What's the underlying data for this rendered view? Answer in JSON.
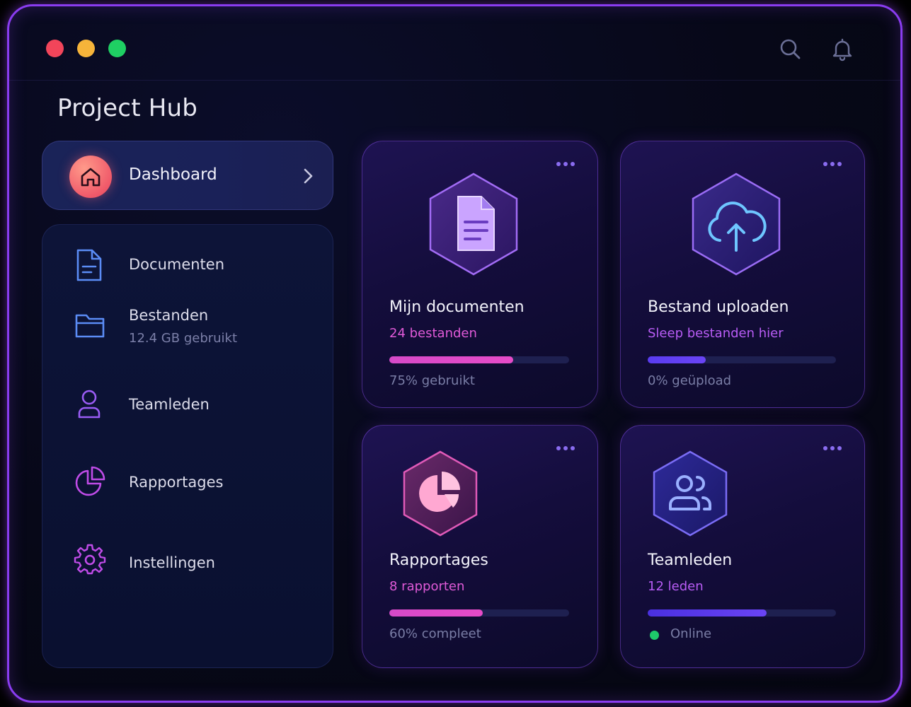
{
  "window": {
    "title": "Project Hub"
  },
  "colors": {
    "accent_purple": "#8a3cf0",
    "pink": "#e64bc8",
    "violet": "#5a3cf0",
    "online_green": "#1ec96a"
  },
  "titlebar": {
    "icons": [
      "search-icon",
      "bell-icon"
    ]
  },
  "sidebar": {
    "dashboard": {
      "label": "Dashboard",
      "icon": "home-icon"
    },
    "items": [
      {
        "label": "Documenten",
        "icon": "document-icon"
      },
      {
        "label": "Bestanden",
        "sub": "12.4 GB gebruikt",
        "icon": "folder-icon"
      },
      {
        "label": "Teamleden",
        "icon": "user-icon"
      },
      {
        "label": "Rapportages",
        "icon": "pie-chart-icon"
      },
      {
        "label": "Instellingen",
        "icon": "gear-icon"
      }
    ]
  },
  "cards": [
    {
      "title": "Mijn documenten",
      "sub": "24 bestanden",
      "progress": 0.69,
      "foot": "75% gebruikt",
      "icon": "document-icon"
    },
    {
      "title": "Bestand uploaden",
      "sub": "Sleep bestanden hier",
      "progress": 0.31,
      "foot": "0% geüpload",
      "icon": "cloud-upload-icon"
    },
    {
      "title": "Rapportages",
      "sub": "8 rapporten",
      "progress": 0.52,
      "foot": "60% compleet",
      "icon": "pie-chart-icon"
    },
    {
      "title": "Teamleden",
      "sub": "12 leden",
      "progress": 0.63,
      "foot": "Online",
      "icon": "users-icon"
    }
  ]
}
